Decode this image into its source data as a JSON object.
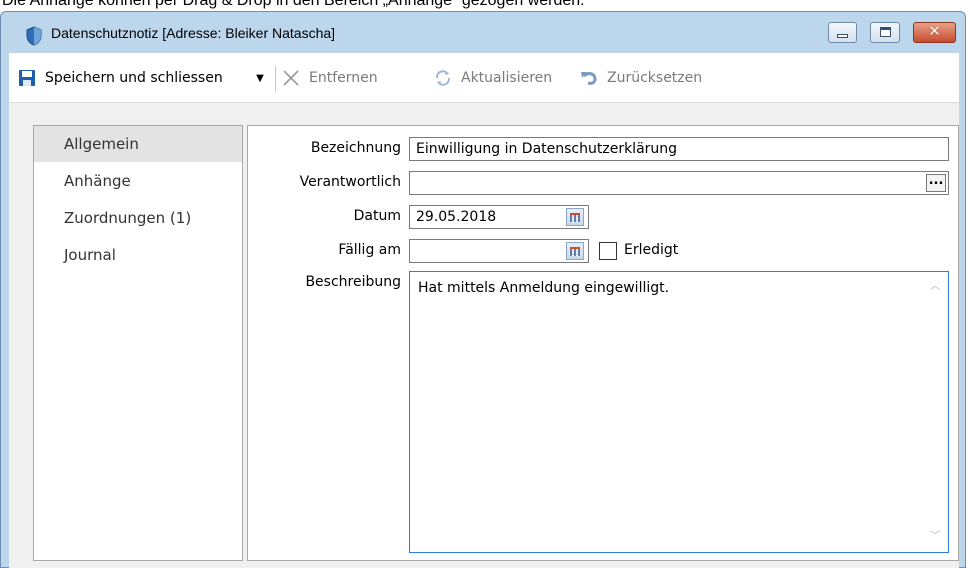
{
  "caption": "Die Anhänge können per Drag & Drop in den Bereich „Anhänge“ gezogen werden.",
  "window": {
    "title": "Datenschutznotiz [Adresse: Bleiker Natascha]",
    "minimize_icon": "minimize-icon",
    "maximize_icon": "maximize-icon",
    "close_glyph": "✕"
  },
  "toolbar": {
    "save_label": "Speichern und schliessen",
    "dropdown_glyph": "▼",
    "remove_label": "Entfernen",
    "refresh_label": "Aktualisieren",
    "reset_label": "Zurücksetzen"
  },
  "nav": {
    "items": [
      {
        "label": "Allgemein",
        "active": true
      },
      {
        "label": "Anhänge",
        "active": false
      },
      {
        "label": "Zuordnungen  (1)",
        "active": false
      },
      {
        "label": "Journal",
        "active": false
      }
    ]
  },
  "form": {
    "bezeichnung_label": "Bezeichnung",
    "bezeichnung_value": "Einwilligung in Datenschutzerklärung",
    "verantwortlich_label": "Verantwortlich",
    "verantwortlich_value": "",
    "ellipsis": "...",
    "datum_label": "Datum",
    "datum_value": "29.05.2018",
    "faellig_label": "Fällig am",
    "faellig_value": "",
    "erledigt_label": "Erledigt",
    "erledigt_checked": false,
    "beschreibung_label": "Beschreibung",
    "beschreibung_value": "Hat mittels Anmeldung eingewilligt."
  },
  "colors": {
    "window_frame": "#bcd6ec",
    "close_button": "#c74c30",
    "focus_border": "#2a7fd4",
    "save_icon": "#1f5fae"
  }
}
